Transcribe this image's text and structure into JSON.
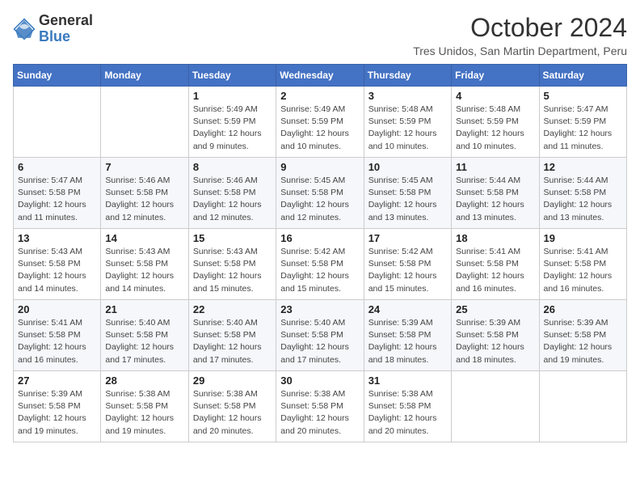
{
  "header": {
    "logo_general": "General",
    "logo_blue": "Blue",
    "month_title": "October 2024",
    "location": "Tres Unidos, San Martin Department, Peru"
  },
  "columns": [
    "Sunday",
    "Monday",
    "Tuesday",
    "Wednesday",
    "Thursday",
    "Friday",
    "Saturday"
  ],
  "weeks": [
    [
      {
        "day": "",
        "info": ""
      },
      {
        "day": "",
        "info": ""
      },
      {
        "day": "1",
        "info": "Sunrise: 5:49 AM\nSunset: 5:59 PM\nDaylight: 12 hours and 9 minutes."
      },
      {
        "day": "2",
        "info": "Sunrise: 5:49 AM\nSunset: 5:59 PM\nDaylight: 12 hours and 10 minutes."
      },
      {
        "day": "3",
        "info": "Sunrise: 5:48 AM\nSunset: 5:59 PM\nDaylight: 12 hours and 10 minutes."
      },
      {
        "day": "4",
        "info": "Sunrise: 5:48 AM\nSunset: 5:59 PM\nDaylight: 12 hours and 10 minutes."
      },
      {
        "day": "5",
        "info": "Sunrise: 5:47 AM\nSunset: 5:59 PM\nDaylight: 12 hours and 11 minutes."
      }
    ],
    [
      {
        "day": "6",
        "info": "Sunrise: 5:47 AM\nSunset: 5:58 PM\nDaylight: 12 hours and 11 minutes."
      },
      {
        "day": "7",
        "info": "Sunrise: 5:46 AM\nSunset: 5:58 PM\nDaylight: 12 hours and 12 minutes."
      },
      {
        "day": "8",
        "info": "Sunrise: 5:46 AM\nSunset: 5:58 PM\nDaylight: 12 hours and 12 minutes."
      },
      {
        "day": "9",
        "info": "Sunrise: 5:45 AM\nSunset: 5:58 PM\nDaylight: 12 hours and 12 minutes."
      },
      {
        "day": "10",
        "info": "Sunrise: 5:45 AM\nSunset: 5:58 PM\nDaylight: 12 hours and 13 minutes."
      },
      {
        "day": "11",
        "info": "Sunrise: 5:44 AM\nSunset: 5:58 PM\nDaylight: 12 hours and 13 minutes."
      },
      {
        "day": "12",
        "info": "Sunrise: 5:44 AM\nSunset: 5:58 PM\nDaylight: 12 hours and 13 minutes."
      }
    ],
    [
      {
        "day": "13",
        "info": "Sunrise: 5:43 AM\nSunset: 5:58 PM\nDaylight: 12 hours and 14 minutes."
      },
      {
        "day": "14",
        "info": "Sunrise: 5:43 AM\nSunset: 5:58 PM\nDaylight: 12 hours and 14 minutes."
      },
      {
        "day": "15",
        "info": "Sunrise: 5:43 AM\nSunset: 5:58 PM\nDaylight: 12 hours and 15 minutes."
      },
      {
        "day": "16",
        "info": "Sunrise: 5:42 AM\nSunset: 5:58 PM\nDaylight: 12 hours and 15 minutes."
      },
      {
        "day": "17",
        "info": "Sunrise: 5:42 AM\nSunset: 5:58 PM\nDaylight: 12 hours and 15 minutes."
      },
      {
        "day": "18",
        "info": "Sunrise: 5:41 AM\nSunset: 5:58 PM\nDaylight: 12 hours and 16 minutes."
      },
      {
        "day": "19",
        "info": "Sunrise: 5:41 AM\nSunset: 5:58 PM\nDaylight: 12 hours and 16 minutes."
      }
    ],
    [
      {
        "day": "20",
        "info": "Sunrise: 5:41 AM\nSunset: 5:58 PM\nDaylight: 12 hours and 16 minutes."
      },
      {
        "day": "21",
        "info": "Sunrise: 5:40 AM\nSunset: 5:58 PM\nDaylight: 12 hours and 17 minutes."
      },
      {
        "day": "22",
        "info": "Sunrise: 5:40 AM\nSunset: 5:58 PM\nDaylight: 12 hours and 17 minutes."
      },
      {
        "day": "23",
        "info": "Sunrise: 5:40 AM\nSunset: 5:58 PM\nDaylight: 12 hours and 17 minutes."
      },
      {
        "day": "24",
        "info": "Sunrise: 5:39 AM\nSunset: 5:58 PM\nDaylight: 12 hours and 18 minutes."
      },
      {
        "day": "25",
        "info": "Sunrise: 5:39 AM\nSunset: 5:58 PM\nDaylight: 12 hours and 18 minutes."
      },
      {
        "day": "26",
        "info": "Sunrise: 5:39 AM\nSunset: 5:58 PM\nDaylight: 12 hours and 19 minutes."
      }
    ],
    [
      {
        "day": "27",
        "info": "Sunrise: 5:39 AM\nSunset: 5:58 PM\nDaylight: 12 hours and 19 minutes."
      },
      {
        "day": "28",
        "info": "Sunrise: 5:38 AM\nSunset: 5:58 PM\nDaylight: 12 hours and 19 minutes."
      },
      {
        "day": "29",
        "info": "Sunrise: 5:38 AM\nSunset: 5:58 PM\nDaylight: 12 hours and 20 minutes."
      },
      {
        "day": "30",
        "info": "Sunrise: 5:38 AM\nSunset: 5:58 PM\nDaylight: 12 hours and 20 minutes."
      },
      {
        "day": "31",
        "info": "Sunrise: 5:38 AM\nSunset: 5:58 PM\nDaylight: 12 hours and 20 minutes."
      },
      {
        "day": "",
        "info": ""
      },
      {
        "day": "",
        "info": ""
      }
    ]
  ]
}
